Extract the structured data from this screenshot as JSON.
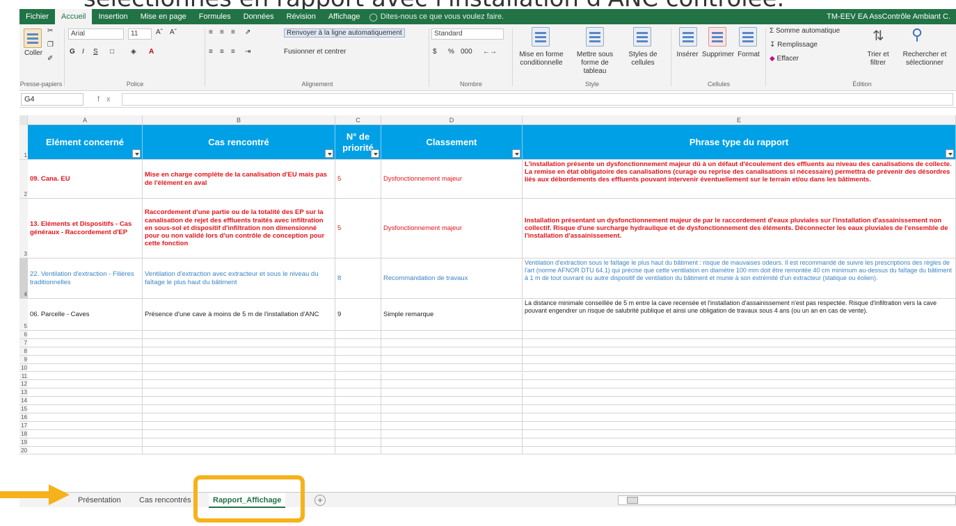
{
  "slide_title": "sélectionnés en rapport avec l'installation d'ANC contrôlée.",
  "ribbon_tabs": [
    "Fichier",
    "Accueil",
    "Insertion",
    "Mise en page",
    "Formules",
    "Données",
    "Révision",
    "Affichage"
  ],
  "tell_me": "Dites-nous ce que vous voulez faire.",
  "user": "TM-EEV EA AssContrôle Ambiant C.",
  "ribbon": {
    "paste": "Coller",
    "clipboard_label": "Presse-papiers",
    "font_name": "Arial",
    "font_size": "11",
    "bold": "G",
    "italic": "I",
    "underline": "S",
    "font_label": "Police",
    "wrap_text": "Renvoyer à la ligne automatiquement",
    "merge_center": "Fusionner et centrer",
    "alignment_label": "Alignement",
    "number_format": "Standard",
    "currency": "$",
    "percent": "%",
    "thousands": "000",
    "number_label": "Nombre",
    "cond_format": "Mise en forme conditionnelle",
    "format_table": "Mettre sous forme de tableau",
    "cell_styles": "Styles de cellules",
    "style_label": "Style",
    "insert": "Insérer",
    "delete": "Supprimer",
    "format": "Format",
    "cells_label": "Cellules",
    "autosum": "Somme automatique",
    "fill": "Remplissage",
    "clear": "Effacer",
    "sort_filter": "Trier et filtrer",
    "find_select": "Rechercher et sélectionner",
    "editing_label": "Édition"
  },
  "name_box": "G4",
  "fx": "fx",
  "columns": [
    "A",
    "B",
    "C",
    "D",
    "E"
  ],
  "row_numbers": [
    "1",
    "2",
    "3",
    "4",
    "5",
    "6",
    "7",
    "8",
    "9",
    "10",
    "11",
    "12",
    "13",
    "14",
    "15",
    "16",
    "17",
    "18",
    "19",
    "20"
  ],
  "headers": [
    "Elément concerné",
    "Cas rencontré",
    "N° de priorité",
    "Classement",
    "Phrase type du rapport"
  ],
  "rows": [
    {
      "style": "red",
      "a": "09. Cana. EU",
      "b": "Mise en charge complète de la canalisation d'EU mais pas de l'élément en aval",
      "c": "5",
      "d": "Dysfonctionnement majeur",
      "e": "L'installation présente un dysfonctionnement majeur dû à un défaut d'écoulement des effluents au niveau des canalisations de collecte. La remise en état obligatoire des canalisations (curage ou reprise des canalisations si nécessaire) permettra de prévenir des désordres liés aux débordements des effluents pouvant intervenir éventuellement sur le terrain et/ou dans les bâtiments."
    },
    {
      "style": "red",
      "a": "13. Eléments et Dispositifs - Cas généraux - Raccordement d'EP",
      "b": "Raccordement d'une partie ou de la totalité des EP sur la canalisation de rejet des effluents traités avec infiltration en sous-sol et dispositif d'infiltration non dimensionné pour ou non validé lors d'un contrôle de conception pour cette fonction",
      "c": "5",
      "d": "Dysfonctionnement majeur",
      "e": "Installation présentant un dysfonctionnement majeur de par le raccordement d'eaux pluviales sur l'installation d'assainissement non collectif. Risque d'une surcharge hydraulique et de dysfonctionnement des éléments. Déconnecter les eaux pluviales de l'ensemble de l'installation d'assainissement."
    },
    {
      "style": "blue",
      "a": "22. Ventilation d'extraction - Filières traditionnelles",
      "b": "Ventilation d'extraction avec extracteur et sous le niveau du faîtage le plus haut du bâtiment",
      "c": "8",
      "d": "Recommandation de travaux",
      "e": "Ventilation d'extraction sous le faîtage le plus haut du bâtiment : risque de mauvaises odeurs. Il est recommandé de suivre les prescriptions des règles de l'art (norme AFNOR DTU 64.1) qui précise que cette ventilation en diamètre 100 mm doit être remontée 40 cm minimum au-dessus du faîtage du bâtiment à 1 m de tout ouvrant ou autre dispositif de ventilation du bâtiment et munie à son extrémité d'un extracteur (statique ou éolien)."
    },
    {
      "style": "blk",
      "a": "06. Parcelle - Caves",
      "b": "Présence d'une cave à moins de 5 m de l'installation d'ANC",
      "c": "9",
      "d": "Simple remarque",
      "e": "La distance minimale conseillée de 5 m entre la cave recensée et l'installation d'assainissement n'est pas respectée. Risque d'infiltration vers la cave pouvant engendrer un risque de salubrité publique et ainsi une obligation de travaux sous 4 ans (ou un an en cas de vente)."
    }
  ],
  "sheet_tabs": [
    "Présentation",
    "Cas rencontrés",
    "Rapport_Affichage"
  ],
  "add_sheet": "+",
  "colors": {
    "excel_green": "#217346",
    "header_blue": "#00a0e6",
    "red_text": "#e3141b",
    "blue_text": "#3a84c6",
    "highlight": "#f6b21b"
  }
}
